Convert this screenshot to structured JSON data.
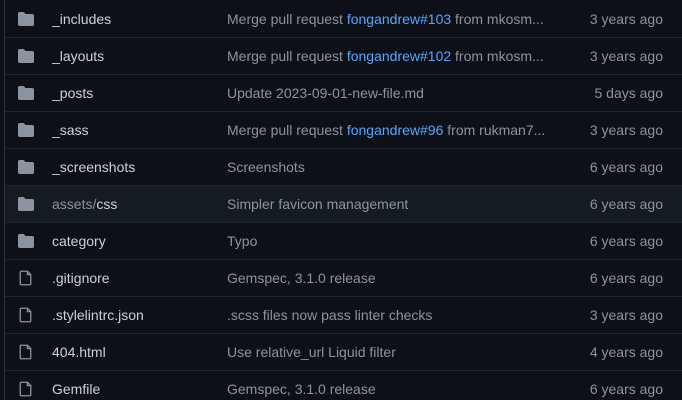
{
  "colors": {
    "background": "#0d1117",
    "text": "#c9d1d9",
    "muted": "#8b949e",
    "link": "#58a6ff",
    "icon": "#8b949e"
  },
  "files": [
    {
      "type": "folder",
      "icon": "folder-icon",
      "name": "_includes",
      "message_prefix": "Merge pull request ",
      "message_link": "fongandrew#103",
      "message_suffix": " from mkosm...",
      "age": "3 years ago"
    },
    {
      "type": "folder",
      "icon": "folder-icon",
      "name": "_layouts",
      "message_prefix": "Merge pull request ",
      "message_link": "fongandrew#102",
      "message_suffix": " from mkosm...",
      "age": "3 years ago"
    },
    {
      "type": "folder",
      "icon": "folder-icon",
      "name": "_posts",
      "message_prefix": "Update 2023-09-01-new-file.md",
      "message_link": "",
      "message_suffix": "",
      "age": "5 days ago"
    },
    {
      "type": "folder",
      "icon": "folder-icon",
      "name": "_sass",
      "message_prefix": "Merge pull request ",
      "message_link": "fongandrew#96",
      "message_suffix": " from rukman7...",
      "age": "3 years ago"
    },
    {
      "type": "folder",
      "icon": "folder-icon",
      "name": "_screenshots",
      "message_prefix": "Screenshots",
      "message_link": "",
      "message_suffix": "",
      "age": "6 years ago"
    },
    {
      "type": "folder",
      "icon": "folder-icon",
      "name_prefix": "assets/",
      "name": "css",
      "message_prefix": "Simpler favicon management",
      "message_link": "",
      "message_suffix": "",
      "age": "6 years ago"
    },
    {
      "type": "folder",
      "icon": "folder-icon",
      "name": "category",
      "message_prefix": "Typo",
      "message_link": "",
      "message_suffix": "",
      "age": "6 years ago"
    },
    {
      "type": "file",
      "icon": "file-icon",
      "name": ".gitignore",
      "message_prefix": "Gemspec, 3.1.0 release",
      "message_link": "",
      "message_suffix": "",
      "age": "6 years ago"
    },
    {
      "type": "file",
      "icon": "file-icon",
      "name": ".stylelintrc.json",
      "message_prefix": ".scss files now pass linter checks",
      "message_link": "",
      "message_suffix": "",
      "age": "3 years ago"
    },
    {
      "type": "file",
      "icon": "file-icon",
      "name": "404.html",
      "message_prefix": "Use relative_url Liquid filter",
      "message_link": "",
      "message_suffix": "",
      "age": "4 years ago"
    },
    {
      "type": "file",
      "icon": "file-icon",
      "name": "Gemfile",
      "message_prefix": "Gemspec, 3.1.0 release",
      "message_link": "",
      "message_suffix": "",
      "age": "6 years ago"
    }
  ]
}
